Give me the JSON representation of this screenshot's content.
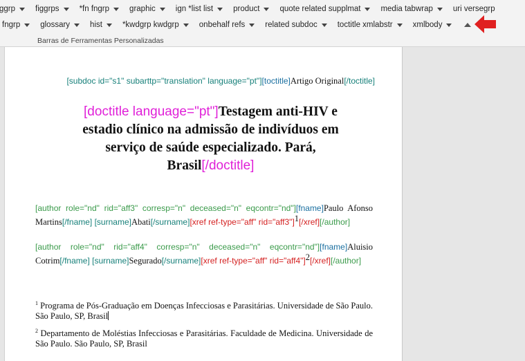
{
  "toolbar": {
    "row1": [
      "ggrp",
      "figgrps",
      "*fn fngrp",
      "graphic",
      "ign *list list",
      "product",
      "quote related supplmat",
      "media tabwrap",
      "uri versegrp"
    ],
    "row2": [
      "fngrp",
      "glossary",
      "hist",
      "*kwdgrp kwdgrp",
      "onbehalf refs",
      "related subdoc",
      "toctitle xmlabstr",
      "xmlbody"
    ],
    "group_label": "Barras de Ferramentas Personalizadas",
    "pointer_color": "#e02020"
  },
  "document": {
    "subdoc": {
      "open_tag": "[subdoc id=\"s1\" subarttp=\"translation\" language=\"pt\"]",
      "toctitle_open": "[toctitle]",
      "text": "Artigo Original",
      "toctitle_close": "[/toctitle]"
    },
    "doctitle": {
      "open_tag": "[doctitle language=\"pt\"]",
      "text_line1": "Testagem anti-HIV e",
      "text_line2": "estadio clínico na admissão de indivíduos em",
      "text_line3": "serviço de saúde especializado. Pará,",
      "text_line4": "Brasil",
      "close_tag": "[/doctitle]"
    },
    "authors": [
      {
        "open_tag": "[author role=\"nd\" rid=\"aff3\" corresp=\"n\" deceased=\"n\" eqcontr=\"nd\"]",
        "fname_open": "[fname]",
        "fname": "Paulo Afonso Martins",
        "fname_close": "[/fname]",
        "surname_open": "[surname]",
        "surname": "Abati",
        "surname_close": "[/surname]",
        "xref_open": "[xref ref-type=\"aff\" rid=\"aff3\"]",
        "xref_num": "1",
        "xref_close": "[/xref]",
        "close_tag": "[/author]"
      },
      {
        "open_tag": "[author role=\"nd\" rid=\"aff4\" corresp=\"n\" deceased=\"n\" eqcontr=\"nd\"]",
        "fname_open": "[fname]",
        "fname": "Aluisio Cotrim",
        "fname_close": "[/fname]",
        "surname_open": "[surname]",
        "surname": "Segurado",
        "surname_close": "[/surname]",
        "xref_open": "[xref ref-type=\"aff\" rid=\"aff4\"]",
        "xref_num": "2",
        "xref_close": "[/xref]",
        "close_tag": "[/author]"
      }
    ],
    "affiliations": [
      {
        "num": "1",
        "text": "Programa de Pós-Graduação em Doenças Infecciosas e Parasitárias. Universidade de São Paulo. São Paulo, SP, Brasil"
      },
      {
        "num": "2",
        "text": "Departamento de Moléstias Infecciosas e Parasitárias. Faculdade de Medicina. Universidade de São Paulo. São Paulo, SP, Brasil"
      }
    ]
  }
}
